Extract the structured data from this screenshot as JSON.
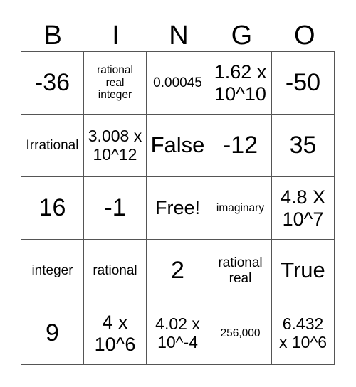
{
  "header": [
    "B",
    "I",
    "N",
    "G",
    "O"
  ],
  "rows": [
    [
      "-36",
      "rational\nreal\ninteger",
      "0.00045",
      "1.62 x\n10^10",
      "-50"
    ],
    [
      "Irrational",
      "3.008 x\n10^12",
      "False",
      "-12",
      "35"
    ],
    [
      "16",
      "-1",
      "Free!",
      "imaginary",
      "4.8 X\n10^7"
    ],
    [
      "integer",
      "rational",
      "2",
      "rational\nreal",
      "True"
    ],
    [
      "9",
      "4 x\n10^6",
      "4.02 x\n10^-4",
      "256,000",
      "6.432\nx 10^6"
    ]
  ]
}
